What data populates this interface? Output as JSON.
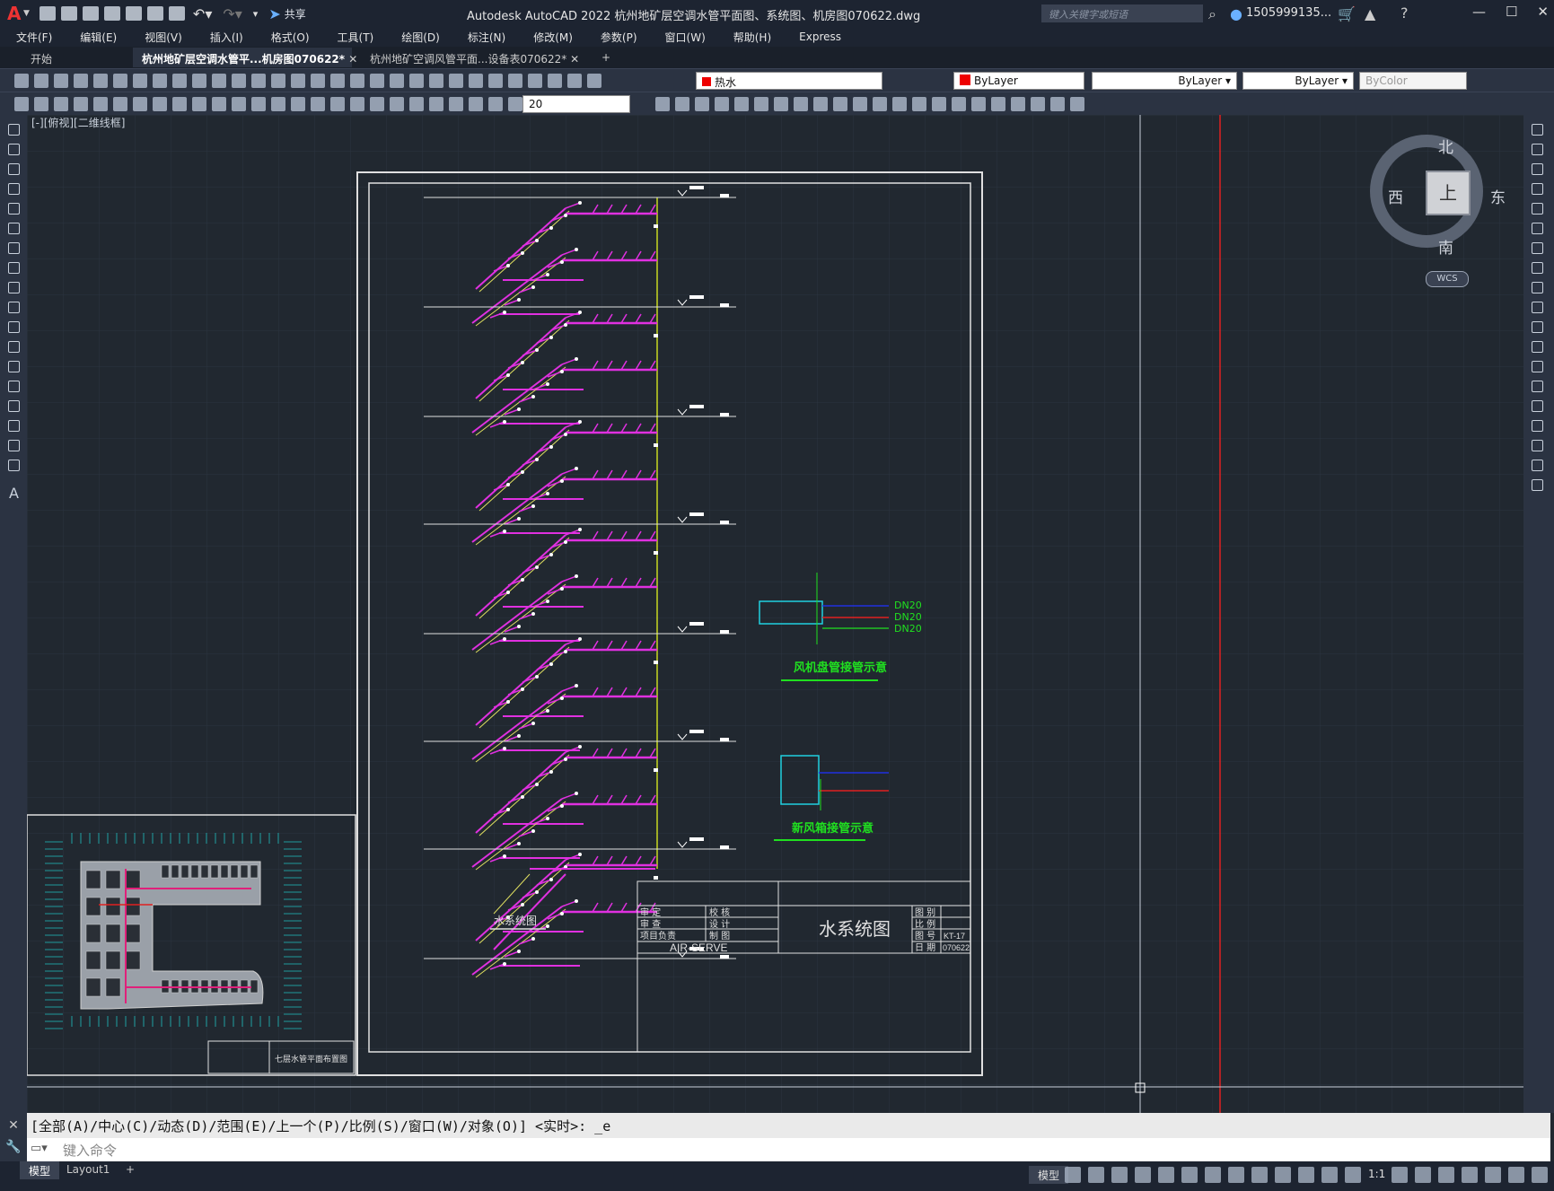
{
  "app": {
    "logo_letter": "A",
    "window_title": "Autodesk AutoCAD 2022    杭州地矿层空调水管平面图、系统图、机房图070622.dwg",
    "share_label": "共享",
    "search_placeholder": "键入关键字或短语",
    "user_name": "1505999135...",
    "window_buttons": [
      "—",
      "☐",
      "✕"
    ]
  },
  "menu": [
    "文件(F)",
    "编辑(E)",
    "视图(V)",
    "插入(I)",
    "格式(O)",
    "工具(T)",
    "绘图(D)",
    "标注(N)",
    "修改(M)",
    "参数(P)",
    "窗口(W)",
    "帮助(H)",
    "Express"
  ],
  "tabs": [
    {
      "label": "开始",
      "active": false
    },
    {
      "label": "杭州地矿层空调水管平...机房图070622*",
      "active": true
    },
    {
      "label": "杭州地矿空调风管平面...设备表070622*",
      "active": false
    }
  ],
  "toolbar": {
    "layer_name": "热水",
    "color": "ByLayer",
    "linetype": "ByLayer",
    "lineweight": "ByLayer",
    "plotstyle": "ByColor",
    "dim_value": "20"
  },
  "viewport_label": "[-][俯视][二维线框]",
  "viewcube": {
    "north": "北",
    "south": "南",
    "east": "东",
    "west": "西",
    "face": "上",
    "wcs": "WCS"
  },
  "drawing": {
    "system_title": "水系统图",
    "fan_coil_title": "风机盘管接管示意",
    "fresh_air_title": "新风箱接管示意",
    "dn_labels": [
      "DN20",
      "DN20",
      "DN20"
    ],
    "titleblock": {
      "company": "AIR-SERVE",
      "name": "水系统图",
      "drawing_no": "KT-17",
      "date": "070622",
      "rows_left": [
        "审 定",
        "审 查",
        "项目负责"
      ],
      "rows_mid": [
        "校 核",
        "设 计",
        "制 图"
      ],
      "rows_right": [
        "图 别",
        "比 例",
        "图 号",
        "日 期"
      ]
    },
    "plan_caption": "七层水管平面布置图"
  },
  "command": {
    "history": "[全部(A)/中心(C)/动态(D)/范围(E)/上一个(P)/比例(S)/窗口(W)/对象(O)] <实时>: _e",
    "input_placeholder": "键入命令"
  },
  "status": {
    "layout_tabs": [
      "模型",
      "Layout1"
    ],
    "model_label": "模型",
    "scale": "1:1"
  },
  "colors": {
    "canvas_bg": "#212830",
    "pipe_supply": "#e030e0",
    "pipe_riser": "#c8d820",
    "text_green": "#20e020",
    "red_line": "#e02020"
  }
}
